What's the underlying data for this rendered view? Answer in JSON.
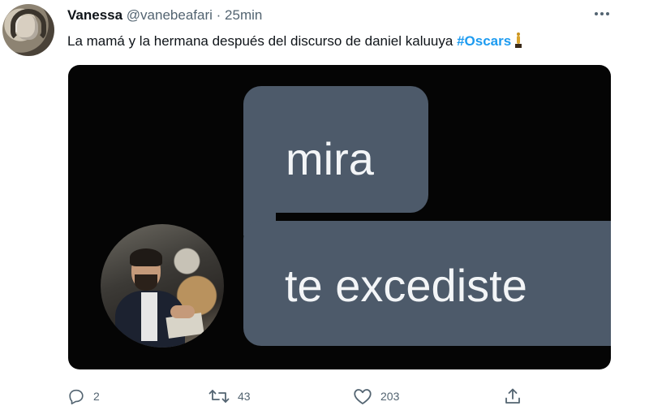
{
  "tweet": {
    "author_name": "Vanessa",
    "author_handle": "@vanebeafari",
    "separator": "·",
    "time": "25min",
    "text_before": "La mamá y la hermana después del discurso de daniel kaluuya ",
    "hashtag": "#Oscars",
    "hashtag_icon": "oscar-statuette-icon"
  },
  "media": {
    "bubble_top_text": "mira",
    "bubble_bottom_text": "te excediste",
    "bubble_color": "#4d5a6a",
    "background_color": "#050505"
  },
  "actions": {
    "reply": {
      "icon": "reply-icon",
      "count": "2"
    },
    "retweet": {
      "icon": "retweet-icon",
      "count": "43"
    },
    "like": {
      "icon": "heart-icon",
      "count": "203"
    },
    "share": {
      "icon": "share-icon"
    }
  },
  "colors": {
    "text": "#0f1419",
    "secondary": "#536471",
    "link": "#1d9bf0"
  }
}
